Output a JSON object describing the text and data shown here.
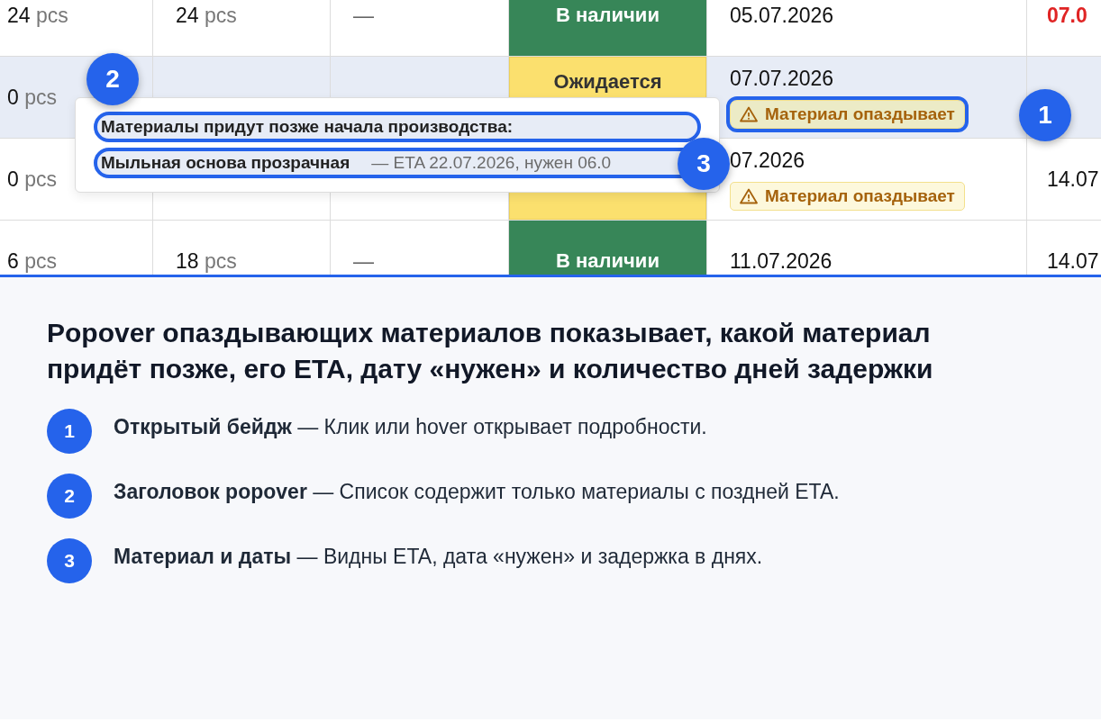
{
  "table": {
    "rows": [
      {
        "highlighted": false,
        "col_1": {
          "qty": "24",
          "unit": "pcs"
        },
        "col_2": {
          "qty": "24",
          "unit": "pcs"
        },
        "col_3": "—",
        "status": {
          "kind": "in_stock",
          "label": "В наличии"
        },
        "date": "05.07.2026",
        "badge": null,
        "col_6": {
          "text": "07.0",
          "late": true
        }
      },
      {
        "highlighted": true,
        "col_1": {
          "qty": "0",
          "unit": "pcs"
        },
        "col_2": null,
        "col_3": null,
        "status": {
          "kind": "expected",
          "label": "Ожидается"
        },
        "date": "07.07.2026",
        "badge": {
          "label": "Материал опаздывает",
          "open": true
        },
        "col_6": null
      },
      {
        "highlighted": false,
        "col_1": {
          "qty": "0",
          "unit": "pcs"
        },
        "col_2": null,
        "col_3": null,
        "status": {
          "kind": "expected"
        },
        "date": "07.2026",
        "badge": {
          "label": "Материал опаздывает",
          "open": false
        },
        "col_6": {
          "text": "14.07",
          "late": false
        }
      },
      {
        "highlighted": false,
        "col_1": {
          "qty": "6",
          "unit": "pcs"
        },
        "col_2": {
          "qty": "18",
          "unit": "pcs"
        },
        "col_3": "—",
        "status": {
          "kind": "in_stock",
          "label": "В наличии"
        },
        "date": "11.07.2026",
        "badge": null,
        "col_6": {
          "text": "14.07",
          "late": false
        }
      }
    ]
  },
  "popover": {
    "lines": [
      {
        "kind": "title",
        "text": "Материалы придут позже начала производства:",
        "highlighted": true
      },
      {
        "kind": "item",
        "text": "**Мыльная основа прозрачная** — ETA 22.07.2026, нужен 06.0",
        "highlighted": true
      }
    ]
  },
  "markers": [
    {
      "number": "1"
    },
    {
      "number": "2"
    },
    {
      "number": "3"
    }
  ],
  "explanation": {
    "heading": "Popover опаздывающих материалов показывает, какой материал придёт позже, его ETA, дату «нужен» и количество дней задержки",
    "items": [
      {
        "number": "1",
        "text": "**Открытый бейдж** — Клик или hover открывает подробности."
      },
      {
        "number": "2",
        "text": "**Заголовок popover** — Список содержит только материалы с поздней ETA."
      },
      {
        "number": "3",
        "text": "**Материал и даты** — Видны ETA, дата «нужен» и задержка в днях."
      }
    ]
  }
}
